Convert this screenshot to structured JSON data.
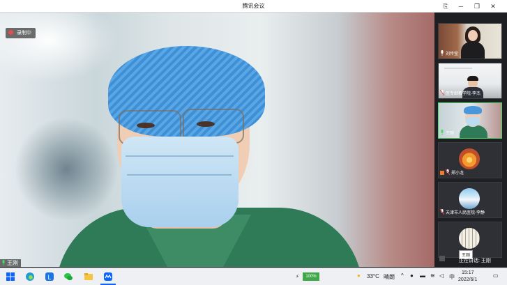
{
  "window": {
    "title": "腾讯会议"
  },
  "recording": {
    "label": "录制中"
  },
  "main_speaker": {
    "name": "王刚"
  },
  "participants": [
    {
      "name": "刘传莹"
    },
    {
      "name": "医专继教学院-李杰"
    },
    {
      "name": "王刚"
    },
    {
      "name": "郑小龙"
    },
    {
      "name": "天津市人民医院-李静"
    },
    {
      "name": ""
    }
  ],
  "speaking": {
    "label": "正在讲话: 王刚"
  },
  "tooltip": {
    "text": "王刚"
  },
  "taskbar": {
    "battery": "100%",
    "temperature": "33°C",
    "weather": "晴朗",
    "ime": "中",
    "time": "15:17",
    "date": "2022/6/1"
  },
  "colors": {
    "sidebar_bg": "#1e1f22",
    "accent": "#0a64ff",
    "record_dot": "#e84b4b"
  }
}
